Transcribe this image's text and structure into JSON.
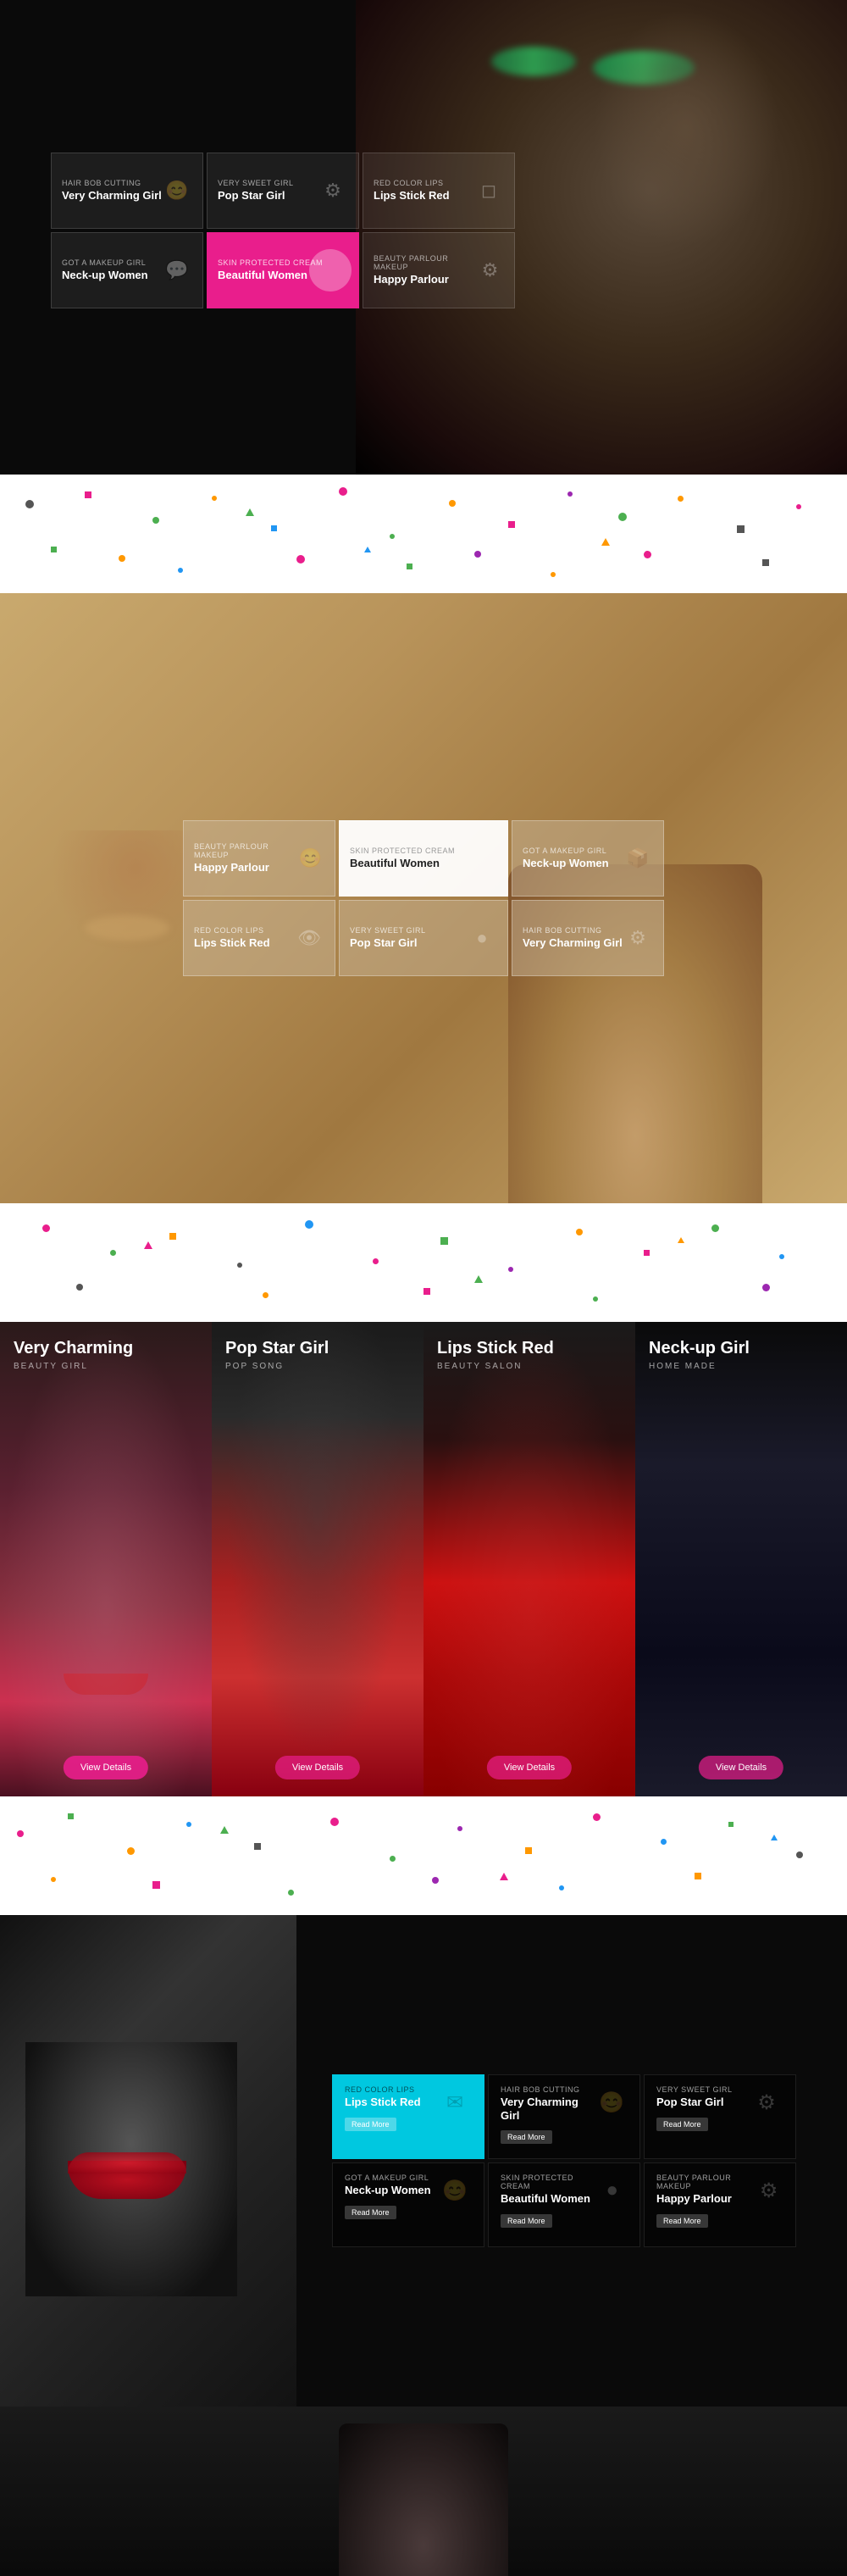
{
  "hero": {
    "cards": [
      {
        "subtitle": "Hair Bob Cutting",
        "title": "Very Charming Girl",
        "icon": "😊",
        "active": false
      },
      {
        "subtitle": "Very Sweet Girl",
        "title": "Pop Star Girl",
        "icon": "⚙️",
        "active": false
      },
      {
        "subtitle": "Red Color Lips",
        "title": "Lips Stick Red",
        "icon": "📦",
        "active": false
      },
      {
        "subtitle": "Got a makeup girl",
        "title": "Neck-up Women",
        "icon": "💬",
        "active": false
      },
      {
        "subtitle": "Skin Protected Cream",
        "title": "Beautiful Women",
        "icon": "●",
        "active": true
      },
      {
        "subtitle": "Beauty Parlour Makeup",
        "title": "Happy Parlour",
        "icon": "⚙️",
        "active": false
      }
    ]
  },
  "golden": {
    "cards": [
      {
        "subtitle": "Beauty Parlour Makeup",
        "title": "Happy Parlour",
        "icon": "😊",
        "active": false
      },
      {
        "subtitle": "Skin Protected Cream",
        "title": "Beautiful Women",
        "icon": "",
        "active": true
      },
      {
        "subtitle": "Got a makeup girl",
        "title": "Neck-up Women",
        "icon": "📦",
        "active": false
      },
      {
        "subtitle": "Red Color Lips",
        "title": "Lips Stick Red",
        "icon": "👁",
        "active": false
      },
      {
        "subtitle": "Very Sweet Girl",
        "title": "Pop Star Girl",
        "icon": "●",
        "active": false
      },
      {
        "subtitle": "Hair Bob Cutting",
        "title": "Very Charming Girl",
        "icon": "⚙️",
        "active": false
      }
    ]
  },
  "gallery": {
    "cards": [
      {
        "title": "Very Charming",
        "subtitle": "BEAUTY GIRL",
        "btn": "View Details"
      },
      {
        "title": "Pop Star Girl",
        "subtitle": "POP SONG",
        "btn": "View Details"
      },
      {
        "title": "Lips Stick Red",
        "subtitle": "BEAUTY SALON",
        "btn": "View Details"
      },
      {
        "title": "Neck-up Girl",
        "subtitle": "HOME MADE",
        "btn": "View Details"
      }
    ]
  },
  "dark": {
    "cards": [
      {
        "subtitle": "Red Color Lips",
        "title": "Lips Stick Red",
        "btn": "Read More",
        "icon": "✉",
        "cyan": true
      },
      {
        "subtitle": "Hair Bob Cutting",
        "title": "Very Charming Girl",
        "btn": "Read More",
        "icon": "😊"
      },
      {
        "subtitle": "Very Sweet Girl",
        "title": "Pop Star Girl",
        "btn": "Read More",
        "icon": "⚙️"
      },
      {
        "subtitle": "Got a makeup girl",
        "title": "Neck-up Women",
        "btn": "Read More",
        "icon": "😊"
      },
      {
        "subtitle": "Skin Protected Cream",
        "title": "Beautiful Women",
        "btn": "Read More",
        "icon": "●"
      },
      {
        "subtitle": "Beauty Parlour Makeup",
        "title": "Happy Parlour",
        "btn": "Read More",
        "icon": "⚙️"
      }
    ]
  }
}
